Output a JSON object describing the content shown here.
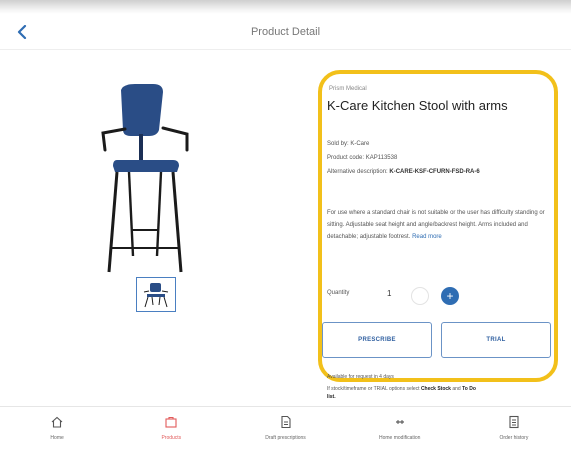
{
  "header": {
    "title": "Product Detail"
  },
  "product": {
    "brand": "Prism Medical",
    "name": "K-Care Kitchen Stool with arms",
    "specs": [
      {
        "label": "Sold by: K-Care",
        "value": ""
      },
      {
        "label": "Product code: ",
        "value": "KAP113538"
      },
      {
        "label": "Alternative description: ",
        "value": "K-CARE-KSF-CFURN-FSD-RA-6"
      }
    ],
    "description": "For use where a standard chair is not suitable or the user has difficulty standing or sitting. Adjustable seat height and angle/backrest height. Arms included and detachable; adjustable footrest.",
    "read_more": "Read more"
  },
  "quantity": {
    "label": "Quantity",
    "value": "1",
    "plus_label": "+"
  },
  "buttons": {
    "prescribe": "PRESCRIBE",
    "trial": "TRIAL"
  },
  "notes": {
    "line1": "Available for request in 4 days",
    "line2_prefix": "If stock/timeframe or TRIAL options select ",
    "line2_link": "Check Stock",
    "line2_mid": " and ",
    "line2_link2": "To Do",
    "line2_suffix": "list."
  },
  "nav": [
    {
      "label": "Home",
      "icon": "home-icon"
    },
    {
      "label": "Products",
      "icon": "products-icon"
    },
    {
      "label": "Draft prescriptions",
      "icon": "document-icon"
    },
    {
      "label": "Home modification",
      "icon": "home-modification-icon"
    },
    {
      "label": "Order history",
      "icon": "order-history-icon"
    }
  ],
  "colors": {
    "accent": "#2f6db3",
    "highlight": "#f2c01a",
    "active_nav": "#e25a5a"
  }
}
